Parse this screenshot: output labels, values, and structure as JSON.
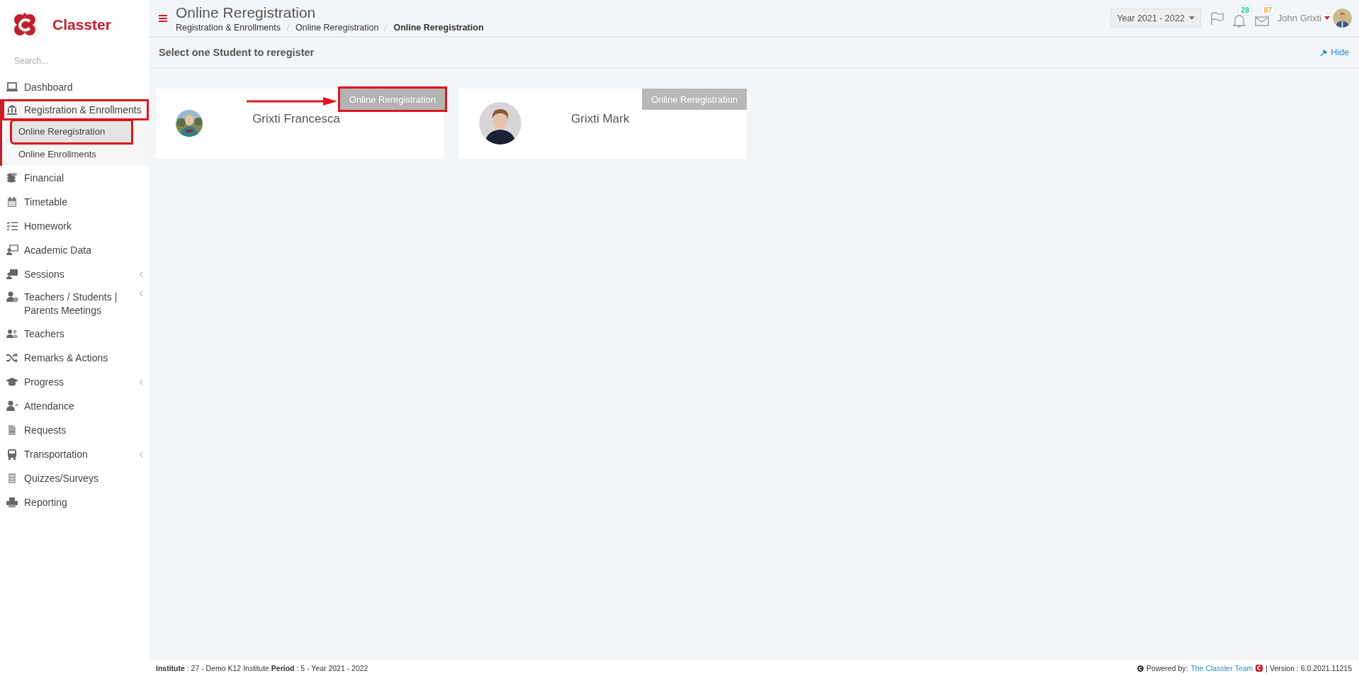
{
  "brand": {
    "name": "Classter"
  },
  "sidebar": {
    "search": {
      "placeholder": "Search..."
    },
    "items": [
      {
        "label": "Dashboard",
        "kind": "plain",
        "highlighted": false
      },
      {
        "label": "Registration & Enrollments",
        "kind": "group",
        "expanded": true,
        "highlighted": true,
        "children": [
          {
            "label": "Online Reregistration",
            "selected": true,
            "highlighted": true
          },
          {
            "label": "Online Enrollments",
            "selected": false,
            "highlighted": false
          }
        ]
      },
      {
        "label": "Financial",
        "kind": "plain",
        "highlighted": false
      },
      {
        "label": "Timetable",
        "kind": "plain",
        "highlighted": false
      },
      {
        "label": "Homework",
        "kind": "plain",
        "highlighted": false
      },
      {
        "label": "Academic Data",
        "kind": "plain",
        "highlighted": false
      },
      {
        "label": "Sessions",
        "kind": "submenu",
        "highlighted": false
      },
      {
        "label": "Teachers / Students | Parents Meetings",
        "kind": "submenu",
        "highlighted": false
      },
      {
        "label": "Teachers",
        "kind": "plain",
        "highlighted": false
      },
      {
        "label": "Remarks & Actions",
        "kind": "plain",
        "highlighted": false
      },
      {
        "label": "Progress",
        "kind": "submenu",
        "highlighted": false
      },
      {
        "label": "Attendance",
        "kind": "plain",
        "highlighted": false
      },
      {
        "label": "Requests",
        "kind": "plain",
        "highlighted": false
      },
      {
        "label": "Transportation",
        "kind": "submenu",
        "highlighted": false
      },
      {
        "label": "Quizzes/Surveys",
        "kind": "plain",
        "highlighted": false
      },
      {
        "label": "Reporting",
        "kind": "plain",
        "highlighted": false
      }
    ]
  },
  "header": {
    "title": "Online Reregistration",
    "breadcrumbs": [
      {
        "label": "Registration & Enrollments",
        "current": false
      },
      {
        "label": "Online Reregistration",
        "current": false
      },
      {
        "label": "Online Reregistration",
        "current": true
      }
    ],
    "year": "Year 2021 - 2022",
    "badges": [
      {
        "count": "28",
        "color": "#1bbc9b"
      },
      {
        "count": "87",
        "color": "#f3a43c"
      }
    ],
    "user": "John Grixti"
  },
  "subheader": {
    "title": "Select one Student to reregister",
    "hide": "Hide"
  },
  "students": [
    {
      "name": "Grixti Francesca",
      "button": "Online Reregistration",
      "highlighted": true
    },
    {
      "name": "Grixti Mark",
      "button": "Online Reregistration",
      "highlighted": false
    }
  ],
  "footer": {
    "info": "**Institute** : 27 - Demo K12 Institute **Period** : 5 - Year 2021 - 2022",
    "powered": "Powered by:",
    "team": "The Classter Team",
    "version": "| Version : 6.0.2021.11215"
  }
}
